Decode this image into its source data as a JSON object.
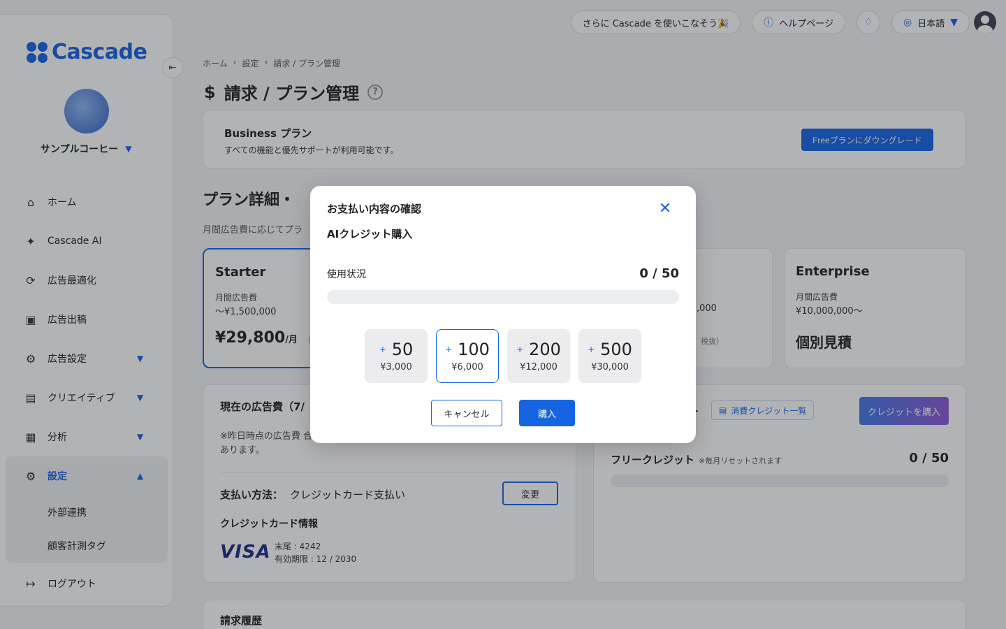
{
  "brand": {
    "name": "Cascade",
    "accent": "#1565e3"
  },
  "header": {
    "promo": "さらに Cascade を使いこなそう🎉",
    "help": "ヘルプページ",
    "language": "日本語"
  },
  "sidebar": {
    "org_name": "サンプルコーヒー",
    "items": [
      {
        "label": "ホーム",
        "icon": "home-icon"
      },
      {
        "label": "Cascade AI",
        "icon": "sparkle-icon"
      },
      {
        "label": "広告最適化",
        "icon": "optimize-icon"
      },
      {
        "label": "広告出稿",
        "icon": "publish-icon"
      },
      {
        "label": "広告設定",
        "icon": "ad-settings-icon"
      },
      {
        "label": "クリエイティブ",
        "icon": "image-icon"
      },
      {
        "label": "分析",
        "icon": "chart-icon"
      },
      {
        "label": "設定",
        "icon": "gear-icon"
      }
    ],
    "settings_sub": [
      "外部連携",
      "顧客計測タグ"
    ],
    "logout": "ログアウト"
  },
  "breadcrumb": [
    "ホーム",
    "設定",
    "請求 / プラン管理"
  ],
  "page_title": "請求 / プラン管理",
  "current_plan": {
    "title": "Business プラン",
    "desc": "すべての機能と優先サポートが利用可能です。",
    "downgrade_label": "Freeプランにダウングレード"
  },
  "plans_section": {
    "title": "プラン詳細・",
    "subtitle": "月間広告費に応じてプラ",
    "starter": {
      "name": "Starter",
      "spend_label": "月間広告費",
      "spend_range": "〜¥1,500,000",
      "price": "¥29,800",
      "unit": "/月",
      "tax": "（税"
    },
    "mid_partial": {
      "range": ",000",
      "tax": "税抜）"
    },
    "enterprise": {
      "name": "Enterprise",
      "spend_label": "月間広告費",
      "spend_range": "¥10,000,000〜",
      "price": "個別見積"
    }
  },
  "ad_spend_card": {
    "title": "現在の広告費（7/",
    "note": "※昨日時点の広告費 合があります。",
    "payment_label": "支払い方法：",
    "payment_value": "クレジットカード支払い",
    "change_label": "変更",
    "cc_title": "クレジットカード情報",
    "card_brand": "VISA",
    "card_last4": "末尾 : 4242",
    "card_expiry": "有効期限 : 12 / 2030"
  },
  "credits_card": {
    "title": "ト",
    "list_label": "消費クレジット一覧",
    "buy_label": "クレジットを購入",
    "free_label": "フリークレジット",
    "free_note": "※毎月リセットされます",
    "free_count": "0 / 50"
  },
  "billing_history": {
    "title": "請求履歴"
  },
  "modal": {
    "title": "お支払い内容の確認",
    "subtitle": "AIクレジット購入",
    "usage_label": "使用状況",
    "usage_count": "0 / 50",
    "usage_fraction": 0,
    "options": [
      {
        "amount": "50",
        "price": "¥3,000",
        "selected": false
      },
      {
        "amount": "100",
        "price": "¥6,000",
        "selected": true
      },
      {
        "amount": "200",
        "price": "¥12,000",
        "selected": false
      },
      {
        "amount": "500",
        "price": "¥30,000",
        "selected": false
      }
    ],
    "cancel_label": "キャンセル",
    "buy_label": "購入"
  }
}
